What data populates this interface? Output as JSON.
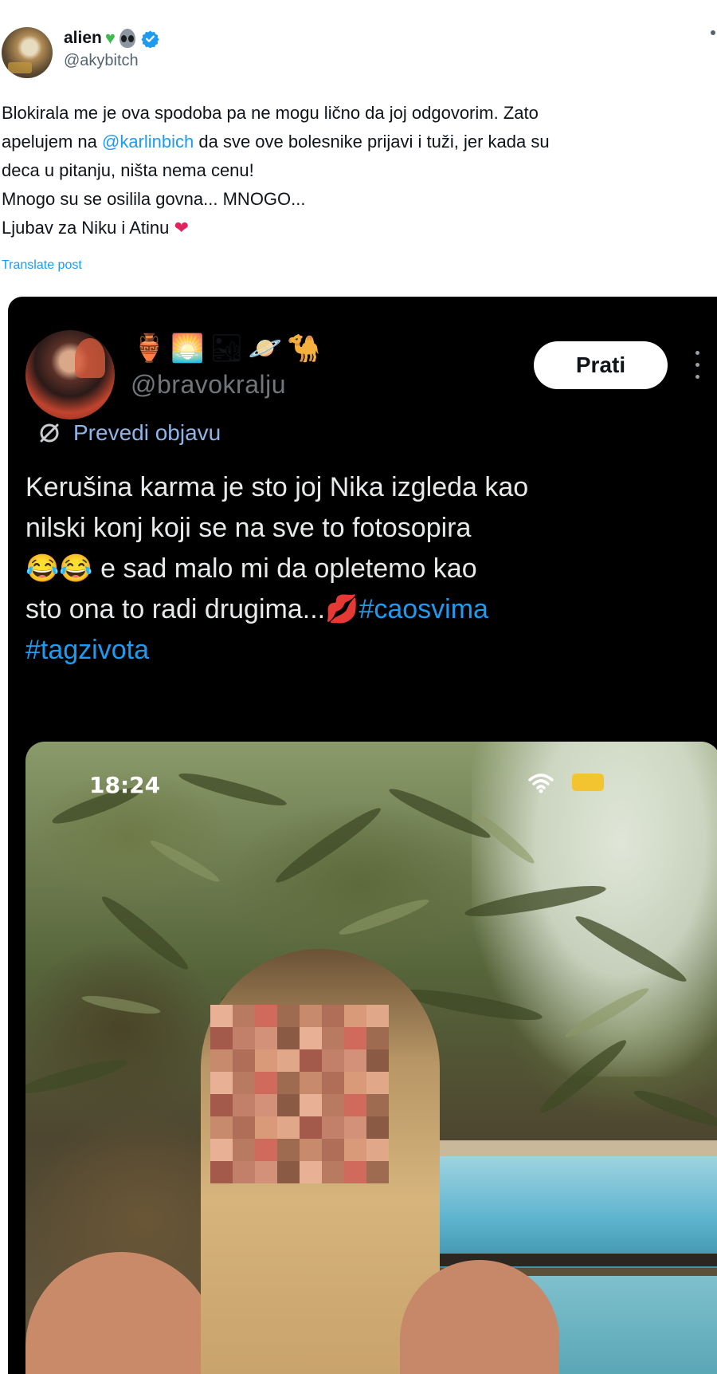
{
  "tweet": {
    "display_name": "alien",
    "name_emojis": [
      "green-heart-icon",
      "alien-icon"
    ],
    "handle": "@akybitch",
    "text_lines": [
      {
        "before": "Blokirala me je ova spodoba pa ne mogu lično da joj odgovorim. Zato",
        "mention": "",
        "after": ""
      },
      {
        "before": "apelujem na ",
        "mention": "@karlinbich",
        "after": " da sve ove bolesnike prijavi i tuži, jer kada su"
      },
      {
        "before": "deca u pitanju, ništa nema cenu!",
        "mention": "",
        "after": ""
      },
      {
        "before": "Mnogo su se osilila govna... MNOGO...",
        "mention": "",
        "after": ""
      },
      {
        "before": "Ljubav za Niku i Atinu",
        "mention": "",
        "after": ""
      }
    ],
    "translate_label": "Translate post"
  },
  "embedded": {
    "header_emojis": [
      "amphora",
      "sunrise",
      "desert",
      "ringed-planet",
      "camel"
    ],
    "handle": "@bravokralju",
    "follow_label": "Prati",
    "translate_label": "Prevedi objavu",
    "text_lines": [
      {
        "before": "Kerušina karma je sto joj Nika izgleda kao",
        "tag": ""
      },
      {
        "before": "nilski konj koji se na sve to fotosopira",
        "tag": ""
      },
      {
        "before": " e sad malo mi da opletemo kao",
        "tag": ""
      },
      {
        "before": "sto ona to radi drugima...",
        "tag": "#caosvima"
      },
      {
        "before": "",
        "tag": "#tagzivota"
      }
    ],
    "photo": {
      "status_time": "18:24"
    }
  },
  "colors": {
    "accent": "#1d9bf0",
    "text_primary": "#0f1419",
    "text_secondary": "#536471",
    "embed_bg": "#000000",
    "embed_text": "#e7e9ea"
  }
}
